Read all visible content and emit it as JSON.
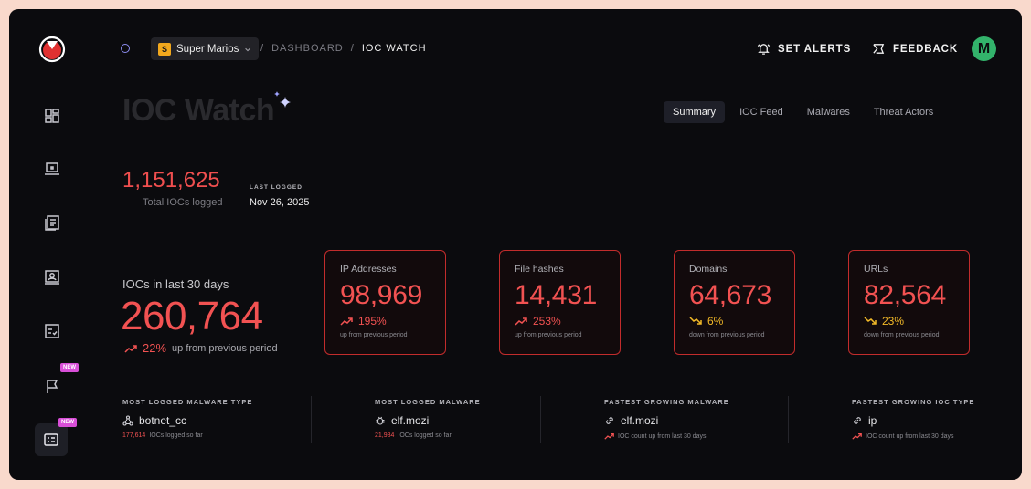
{
  "topbar": {
    "org_initial": "S",
    "org_name": "Super Marios",
    "crumb_sep": "/",
    "crumb_dashboard": "DASHBOARD",
    "crumb_current": "IOC WATCH",
    "alerts_label": "SET ALERTS",
    "feedback_label": "FEEDBACK",
    "avatar_initial": "M"
  },
  "sidebar": {
    "new_badge_1": "NEW",
    "new_badge_2": "NEW"
  },
  "page": {
    "title": "IOC Watch",
    "tabs": [
      "Summary",
      "IOC Feed",
      "Malwares",
      "Threat Actors"
    ]
  },
  "totals": {
    "total_value": "1,151,625",
    "total_label": "Total IOCs logged",
    "last_logged_label": "LAST LOGGED",
    "last_logged_value": "Nov 26, 2025"
  },
  "last30": {
    "label": "IOCs in last 30 days",
    "value": "260,764",
    "change": "22%",
    "change_note": "up from previous period"
  },
  "cards": [
    {
      "label": "IP Addresses",
      "value": "98,969",
      "change": "195%",
      "note": "up from previous period",
      "direction": "up"
    },
    {
      "label": "File hashes",
      "value": "14,431",
      "change": "253%",
      "note": "up from previous period",
      "direction": "up"
    },
    {
      "label": "Domains",
      "value": "64,673",
      "change": "6%",
      "note": "down from previous period",
      "direction": "down"
    },
    {
      "label": "URLs",
      "value": "82,564",
      "change": "23%",
      "note": "down from previous period",
      "direction": "down"
    }
  ],
  "stats": [
    {
      "heading": "MOST LOGGED MALWARE TYPE",
      "value": "botnet_cc",
      "count": "177,614",
      "note": "IOCs logged so far",
      "icon": "network-icon"
    },
    {
      "heading": "MOST LOGGED MALWARE",
      "value": "elf.mozi",
      "count": "21,984",
      "note": "IOCs logged so far",
      "icon": "bug-icon"
    },
    {
      "heading": "FASTEST GROWING MALWARE",
      "value": "elf.mozi",
      "note": "IOC count up from last 30 days",
      "icon": "link-icon"
    },
    {
      "heading": "FASTEST GROWING IOC TYPE",
      "value": "ip",
      "note": "IOC count up from last 30 days",
      "icon": "link-icon"
    }
  ],
  "colors": {
    "accent_red": "#f25252",
    "warn_yellow": "#f2b928",
    "avatar_green": "#33b36b",
    "badge_pink": "#d94fd8"
  }
}
